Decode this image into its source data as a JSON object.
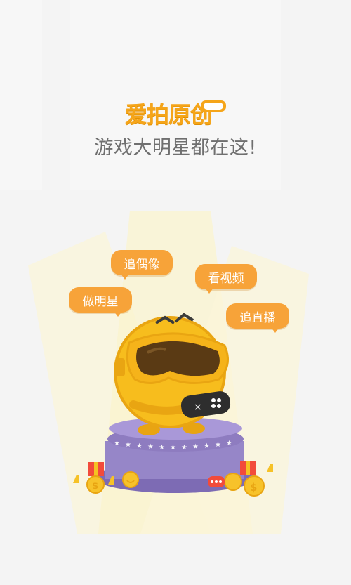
{
  "brand": {
    "logo_text": "爱拍原创"
  },
  "tagline": "游戏大明星都在这!",
  "bubbles": [
    {
      "label": "追偶像"
    },
    {
      "label": "看视频"
    },
    {
      "label": "做明星"
    },
    {
      "label": "追直播"
    }
  ],
  "colors": {
    "brand_orange": "#f5a51a",
    "bubble_orange": "#f7a339",
    "pedestal_purple": "#9a86cc",
    "mascot_yellow": "#f7bd1d"
  }
}
